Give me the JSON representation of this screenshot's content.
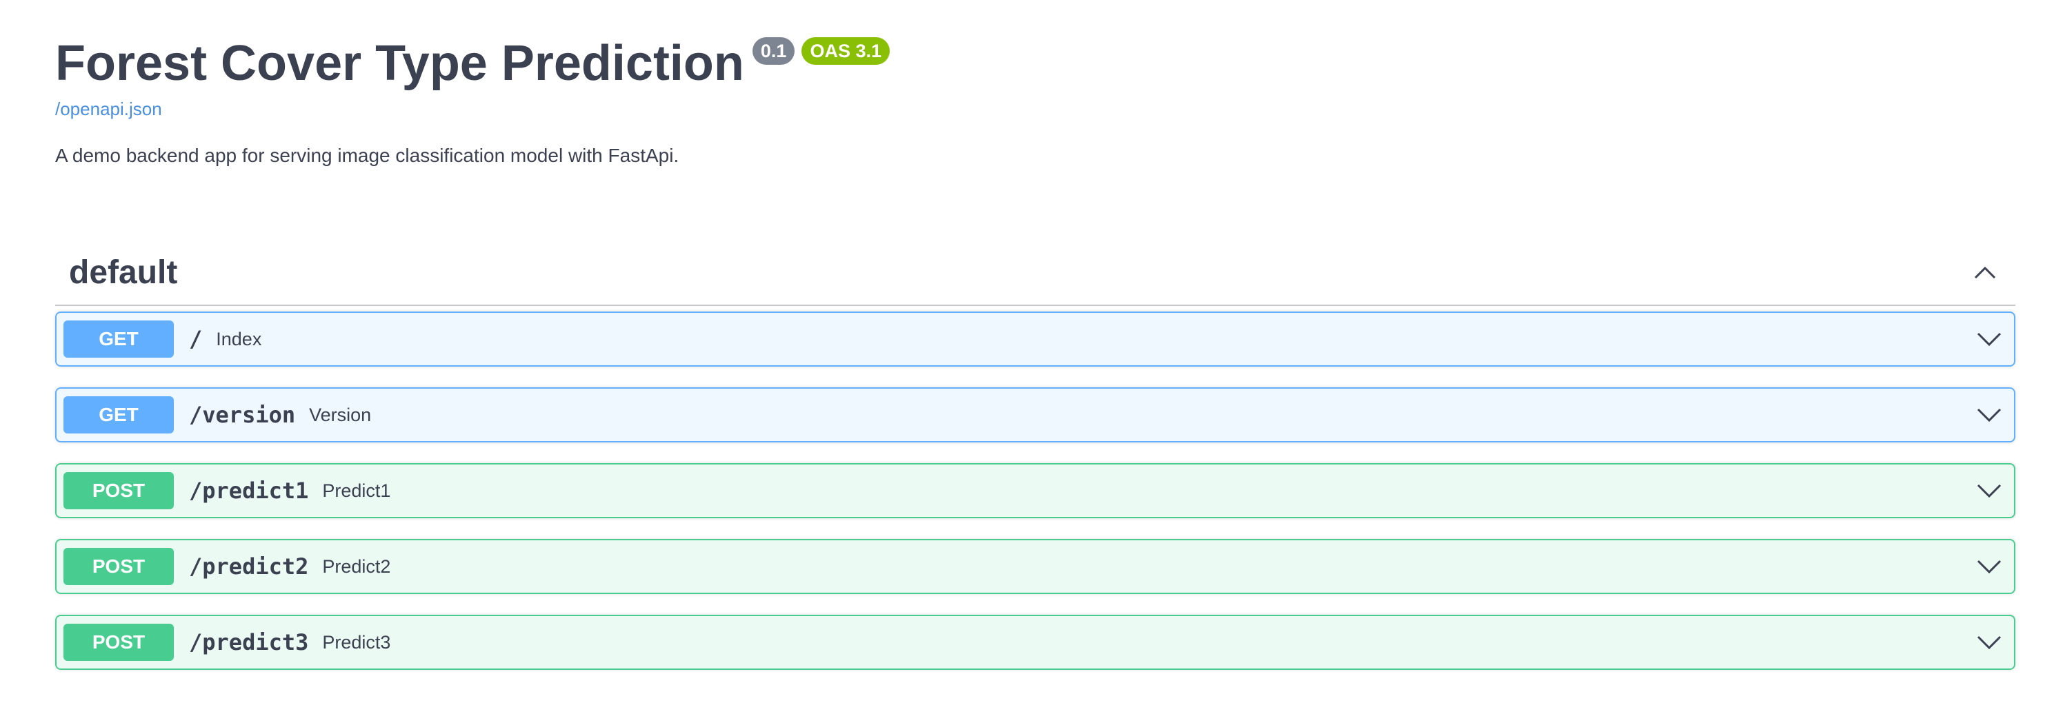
{
  "info": {
    "title": "Forest Cover Type Prediction",
    "version_badge": "0.1",
    "oas_badge": "OAS 3.1",
    "spec_link": "/openapi.json",
    "description": "A demo backend app for serving image classification model with FastApi."
  },
  "tag": {
    "name": "default",
    "toggle_icon": "chevron-up-icon"
  },
  "operations": [
    {
      "method": "GET",
      "path": "/",
      "summary": "Index"
    },
    {
      "method": "GET",
      "path": "/version",
      "summary": "Version"
    },
    {
      "method": "POST",
      "path": "/predict1",
      "summary": "Predict1"
    },
    {
      "method": "POST",
      "path": "/predict2",
      "summary": "Predict2"
    },
    {
      "method": "POST",
      "path": "/predict3",
      "summary": "Predict3"
    }
  ],
  "colors": {
    "get": "#61affe",
    "post": "#49cc90",
    "version_badge": "#7d8492",
    "oas_badge": "#89bf04",
    "link": "#4990e2",
    "text": "#3b4151"
  }
}
